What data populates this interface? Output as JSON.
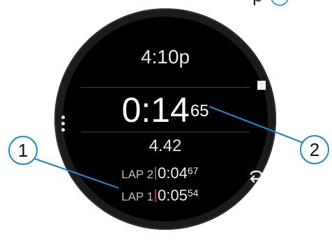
{
  "header": {
    "fragment_text": "p",
    "fragment_marker": "◯"
  },
  "watch": {
    "time_of_day": "4:10p",
    "timer_main": "0:14",
    "timer_hundredths": "65",
    "distance": "4.42",
    "laps": [
      {
        "label": "LAP 2",
        "time_main": "0:04",
        "time_hundredths": "67"
      },
      {
        "label": "LAP 1",
        "time_main": "0:05",
        "time_hundredths": "54"
      }
    ]
  },
  "callouts": {
    "one": "1",
    "two": "2"
  },
  "icons": {
    "menu": "menu-dots-icon",
    "stop": "stop-square-icon",
    "lap": "lap-loop-icon"
  },
  "colors": {
    "callout_border": "#1f86cc",
    "lap_active_bar": "#d4202a",
    "face": "#000000",
    "bezel": "#1b1b1b"
  }
}
